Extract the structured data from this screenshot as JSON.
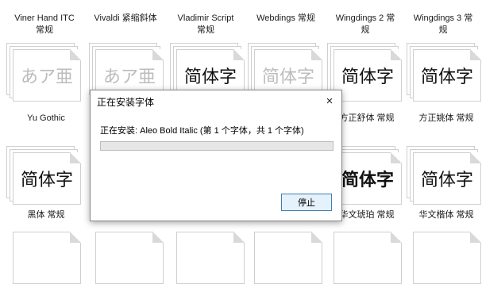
{
  "fonts": {
    "row1": [
      {
        "label": "Viner Hand ITC\n常规"
      },
      {
        "label": "Vivaldi 紧缩斜体"
      },
      {
        "label": "Vladimir Script\n常规"
      },
      {
        "label": "Webdings 常规"
      },
      {
        "label": "Wingdings 2 常\n规"
      },
      {
        "label": "Wingdings 3 常\n规"
      }
    ],
    "row2": [
      {
        "sample": "あア亜",
        "label": "Yu Gothic"
      },
      {
        "sample": "あア亜",
        "label": ""
      },
      {
        "sample": "简体字",
        "label": ""
      },
      {
        "sample": "简体字",
        "label": ""
      },
      {
        "sample": "简体字",
        "label": "方正舒体 常规"
      },
      {
        "sample": "简体字",
        "label": "方正姚体 常规"
      }
    ],
    "row3": [
      {
        "sample": "简体字",
        "label": "黑体 常规"
      },
      {
        "sample": "",
        "label": ""
      },
      {
        "sample": "",
        "label": ""
      },
      {
        "sample": "",
        "label": ""
      },
      {
        "sample": "简体字",
        "label": "华文琥珀 常规"
      },
      {
        "sample": "简体字",
        "label": "华文楷体 常规"
      }
    ]
  },
  "dialog": {
    "title": "正在安装字体",
    "status": "正在安装: Aleo Bold Italic (第 1 个字体，共 1 个字体)",
    "progress": 0,
    "stop_label": "停止",
    "close_icon": "×"
  }
}
